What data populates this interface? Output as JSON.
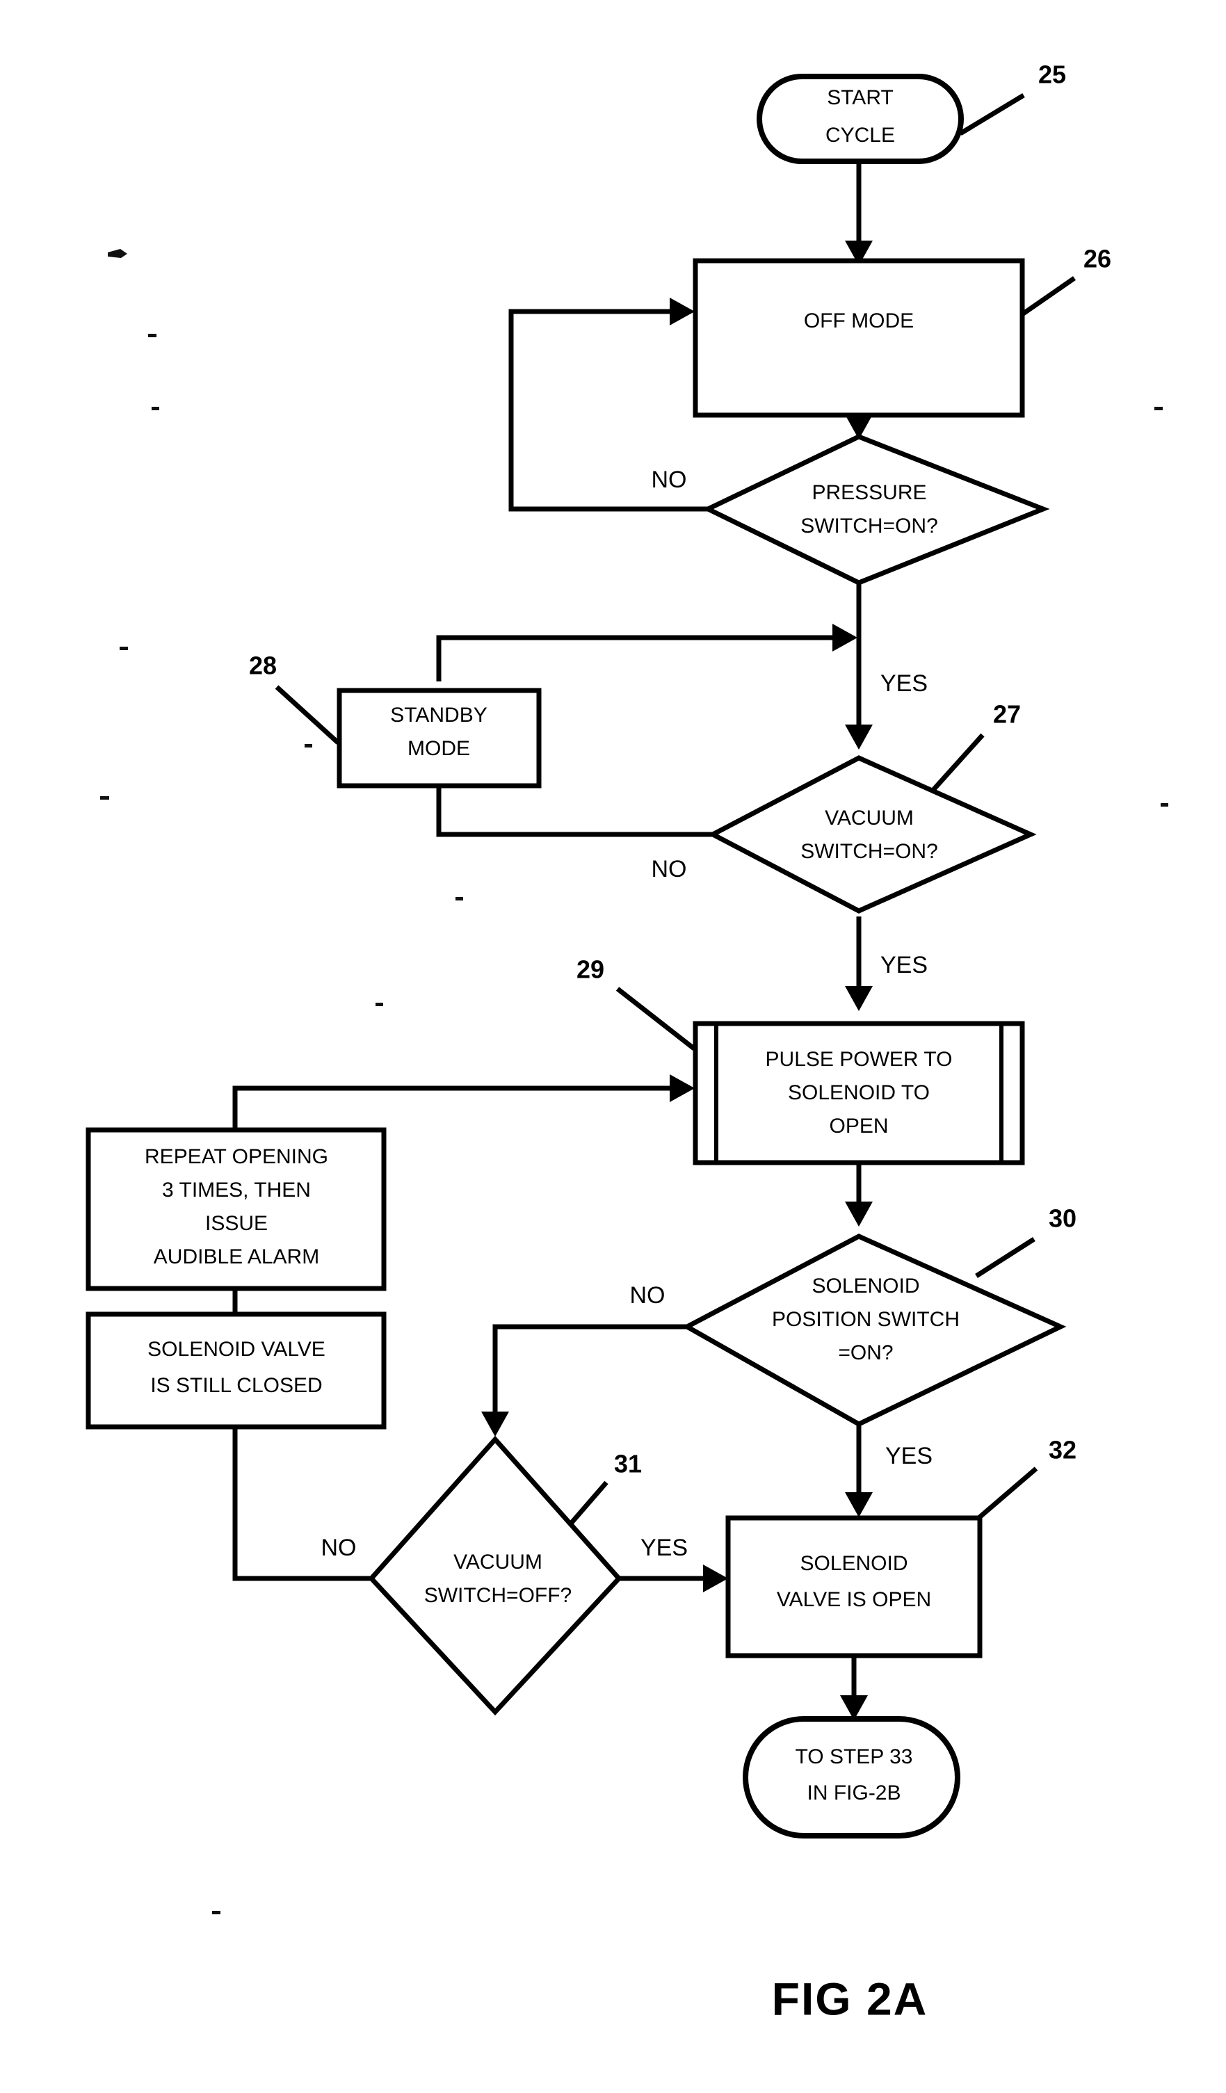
{
  "figure": {
    "caption": "FIG 2A",
    "nodes": [
      {
        "id": "start",
        "ref": "25",
        "shape": "terminator",
        "lines": [
          "START",
          "CYCLE"
        ]
      },
      {
        "id": "off_mode",
        "ref": "26",
        "shape": "process",
        "lines": [
          "OFF MODE"
        ]
      },
      {
        "id": "pressure_switch",
        "ref": "",
        "shape": "decision",
        "lines": [
          "PRESSURE",
          "SWITCH=ON?"
        ]
      },
      {
        "id": "standby_mode",
        "ref": "28",
        "shape": "process",
        "lines": [
          "STANDBY",
          "MODE"
        ]
      },
      {
        "id": "vacuum_switch_on",
        "ref": "27",
        "shape": "decision",
        "lines": [
          "VACUUM",
          "SWITCH=ON?"
        ]
      },
      {
        "id": "pulse_power",
        "ref": "29",
        "shape": "predefined-process",
        "lines": [
          "PULSE POWER TO",
          "SOLENOID TO",
          "OPEN"
        ]
      },
      {
        "id": "repeat_opening",
        "ref": "",
        "shape": "process",
        "lines": [
          "REPEAT OPENING",
          "3 TIMES, THEN",
          "ISSUE",
          "AUDIBLE ALARM"
        ]
      },
      {
        "id": "valve_still_closed",
        "ref": "",
        "shape": "process",
        "lines": [
          "SOLENOID VALVE",
          "IS STILL CLOSED"
        ]
      },
      {
        "id": "position_switch",
        "ref": "30",
        "shape": "decision",
        "lines": [
          "SOLENOID",
          "POSITION SWITCH",
          "=ON?"
        ]
      },
      {
        "id": "vacuum_switch_off",
        "ref": "31",
        "shape": "decision",
        "lines": [
          "VACUUM",
          "SWITCH=OFF?"
        ]
      },
      {
        "id": "valve_open",
        "ref": "32",
        "shape": "process",
        "lines": [
          "SOLENOID",
          "VALVE IS OPEN"
        ]
      },
      {
        "id": "to_step_33",
        "ref": "",
        "shape": "terminator",
        "lines": [
          "TO STEP 33",
          "IN FIG-2B"
        ]
      }
    ],
    "edge_labels": {
      "pressure_no": "NO",
      "pressure_yes": "YES",
      "vacuum_on_no": "NO",
      "vacuum_on_yes": "YES",
      "position_no": "NO",
      "position_yes": "YES",
      "vacuum_off_no": "NO",
      "vacuum_off_yes": "YES"
    },
    "ref_numerals": [
      "25",
      "26",
      "27",
      "28",
      "29",
      "30",
      "31",
      "32"
    ],
    "colors": {
      "ink": "#000000",
      "paper": "#ffffff"
    }
  }
}
